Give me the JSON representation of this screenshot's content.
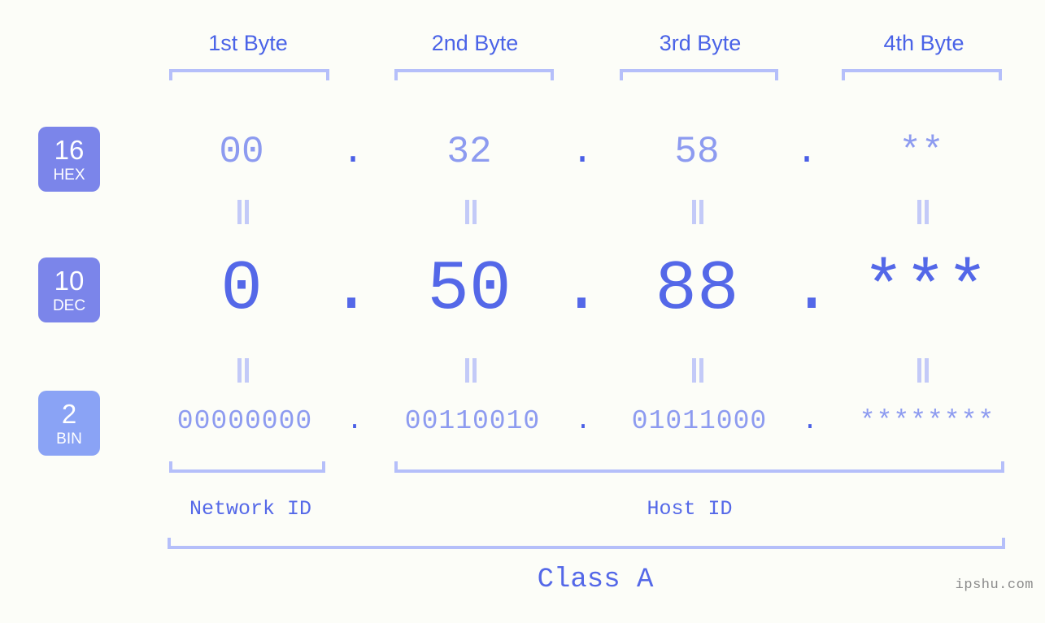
{
  "background_color": "#fcfdf8",
  "accent_color": "#5468e8",
  "muted_accent_color": "#8d9bf0",
  "bracket_color": "#b5bffa",
  "byte_headers": [
    {
      "label": "1st Byte"
    },
    {
      "label": "2nd Byte"
    },
    {
      "label": "3rd Byte"
    },
    {
      "label": "4th Byte"
    }
  ],
  "rows": {
    "hex": {
      "badge_number": "16",
      "badge_unit": "HEX",
      "badge_color": "#7b85ea",
      "values": [
        "00",
        "32",
        "58",
        "**"
      ],
      "separator": "."
    },
    "dec": {
      "badge_number": "10",
      "badge_unit": "DEC",
      "badge_color": "#7b85ea",
      "values": [
        "0",
        "50",
        "88",
        "***"
      ],
      "separator": "."
    },
    "bin": {
      "badge_number": "2",
      "badge_unit": "BIN",
      "badge_color": "#8aa3f5",
      "values": [
        "00000000",
        "00110010",
        "01011000",
        "********"
      ],
      "separator": "."
    }
  },
  "footer": {
    "network_id_label": "Network ID",
    "host_id_label": "Host ID",
    "class_label": "Class A"
  },
  "watermark": "ipshu.com",
  "chart_data": {
    "type": "table",
    "title": "IP Address Byte Breakdown",
    "columns": [
      "1st Byte",
      "2nd Byte",
      "3rd Byte",
      "4th Byte"
    ],
    "rows": [
      {
        "radix": 16,
        "name": "HEX",
        "values": [
          "00",
          "32",
          "58",
          "**"
        ]
      },
      {
        "radix": 10,
        "name": "DEC",
        "values": [
          "0",
          "50",
          "88",
          "***"
        ]
      },
      {
        "radix": 2,
        "name": "BIN",
        "values": [
          "00000000",
          "00110010",
          "01011000",
          "********"
        ]
      }
    ],
    "network_id_bytes": [
      1
    ],
    "host_id_bytes": [
      2,
      3,
      4
    ],
    "address_class": "Class A"
  }
}
